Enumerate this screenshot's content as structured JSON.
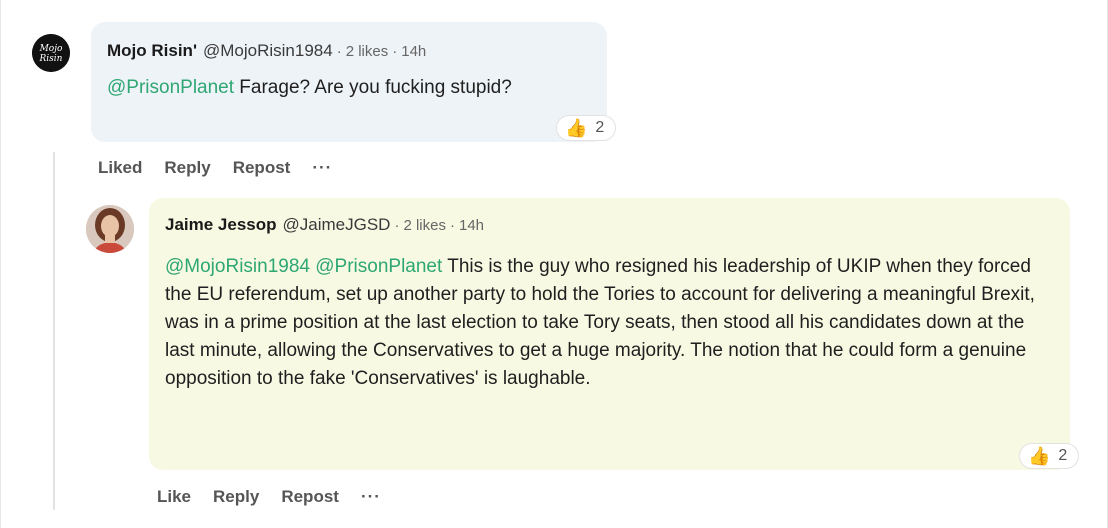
{
  "comment1": {
    "author": "Mojo Risin'",
    "handle": "@MojoRisin1984",
    "likes": "2 likes",
    "time": "14h",
    "mention": "@PrisonPlanet",
    "text": " Farage? Are you fucking stupid?",
    "reaction_count": "2",
    "actions": {
      "like": "Liked",
      "reply": "Reply",
      "repost": "Repost",
      "more": "···"
    }
  },
  "comment2": {
    "author": "Jaime Jessop",
    "handle": "@JaimeJGSD",
    "likes": "2 likes",
    "time": "14h",
    "mention1": "@MojoRisin1984",
    "mention2": "@PrisonPlanet",
    "text": " This is the guy who resigned his leadership of UKIP when they forced the EU referendum, set up another party to hold the Tories to account for delivering a meaningful Brexit, was in a prime position at the last election to take Tory seats, then stood all his candidates down at the last minute, allowing the Conservatives to get a huge majority. The notion that he could form a genuine opposition to the fake 'Conservatives' is laughable.",
    "reaction_count": "2",
    "actions": {
      "like": "Like",
      "reply": "Reply",
      "repost": "Repost",
      "more": "···"
    }
  },
  "avatar1_script_text": "Mojo Risin",
  "separator": "·",
  "icons": {
    "reaction": "thumbs-up-icon"
  },
  "colors": {
    "mention": "#2ea773",
    "bubble1": "#eef3f8",
    "bubble2": "#f7f9e3"
  }
}
